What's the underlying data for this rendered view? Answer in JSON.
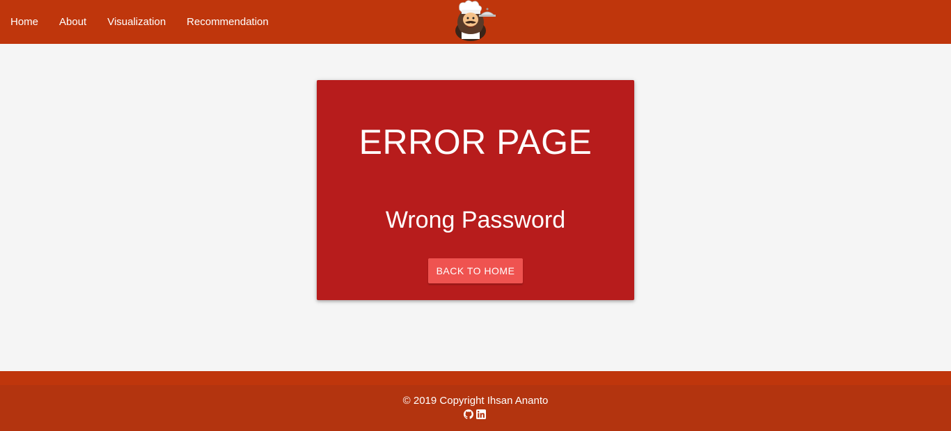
{
  "navbar": {
    "links": [
      "Home",
      "About",
      "Visualization",
      "Recommendation"
    ],
    "logo_icon": "chef-logo-icon",
    "background": "#bf360c"
  },
  "error": {
    "title": "ERROR PAGE",
    "message": "Wrong Password",
    "button_label": "BACK TO HOME",
    "card_color": "#b71c1c",
    "button_color": "#ef5350"
  },
  "footer": {
    "copyright": "© 2019 Copyright Ihsan Ananto",
    "icons": [
      "github-icon",
      "linkedin-icon"
    ]
  }
}
